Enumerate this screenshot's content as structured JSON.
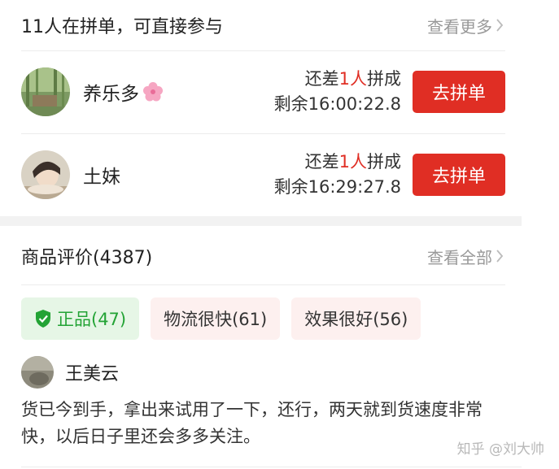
{
  "group_buy": {
    "title": "11人在拼单，可直接参与",
    "more_label": "查看更多",
    "rows": [
      {
        "name": "养乐多",
        "need_prefix": "还差",
        "need_count": "1人",
        "need_suffix": "拼成",
        "remaining": "剩余16:00:22.8",
        "button": "去拼单"
      },
      {
        "name": "土妹",
        "need_prefix": "还差",
        "need_count": "1人",
        "need_suffix": "拼成",
        "remaining": "剩余16:29:27.8",
        "button": "去拼单"
      }
    ]
  },
  "reviews": {
    "title": "商品评价(4387)",
    "more_label": "查看全部",
    "tags": [
      {
        "label": "正品(47)",
        "active": true
      },
      {
        "label": "物流很快(61)",
        "active": false
      },
      {
        "label": "效果很好(56)",
        "active": false
      }
    ],
    "first_review": {
      "name": "王美云",
      "text": "货已今到手，拿出来试用了一下，还行，两天就到货速度非常快，以后日子里还会多多关注。"
    }
  },
  "watermark": "知乎 @刘大帅",
  "colors": {
    "accent_red": "#e02e24",
    "tag_green": "#23a335",
    "tag_green_bg": "#e6f6e6",
    "tag_pink_bg": "#fdf0ef"
  }
}
